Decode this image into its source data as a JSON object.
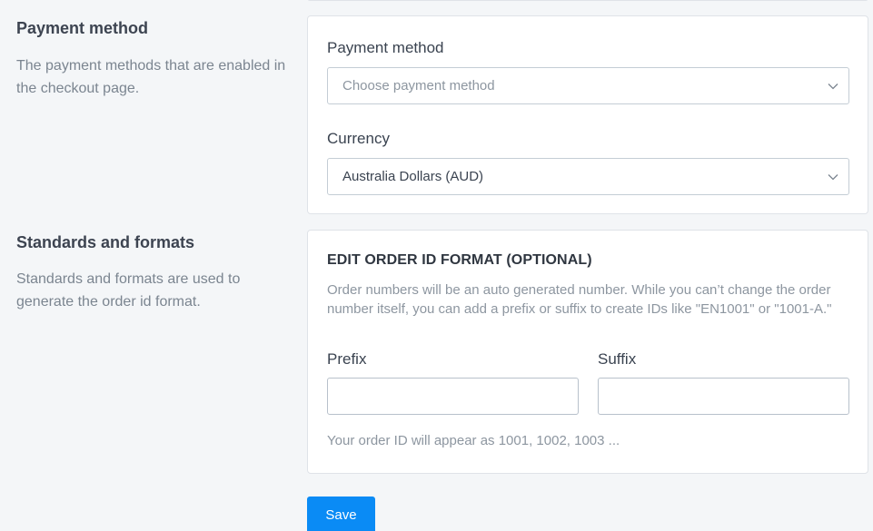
{
  "payment_section": {
    "title": "Payment method",
    "description": "The payment methods that are enabled in the checkout page.",
    "payment_method": {
      "label": "Payment method",
      "placeholder": "Choose payment method"
    },
    "currency": {
      "label": "Currency",
      "value": "Australia Dollars (AUD)"
    }
  },
  "standards_section": {
    "title": "Standards and formats",
    "description": "Standards and formats are used to generate the order id format.",
    "card_heading": "EDIT ORDER ID FORMAT (OPTIONAL)",
    "help_text": "Order numbers will be an auto generated number. While you can’t change the order number itself, you can add a prefix or suffix to create IDs like \"EN1001\" or \"1001-A.\"",
    "prefix": {
      "label": "Prefix",
      "value": ""
    },
    "suffix": {
      "label": "Suffix",
      "value": ""
    },
    "preview_text": "Your order ID will appear as 1001, 1002, 1003 ..."
  },
  "actions": {
    "save_label": "Save"
  },
  "colors": {
    "primary": "#0a8bf5",
    "border": "#c4cdd5",
    "muted_text": "#8d96a0"
  },
  "icons": {
    "dropdown": "chevron-down-icon"
  }
}
